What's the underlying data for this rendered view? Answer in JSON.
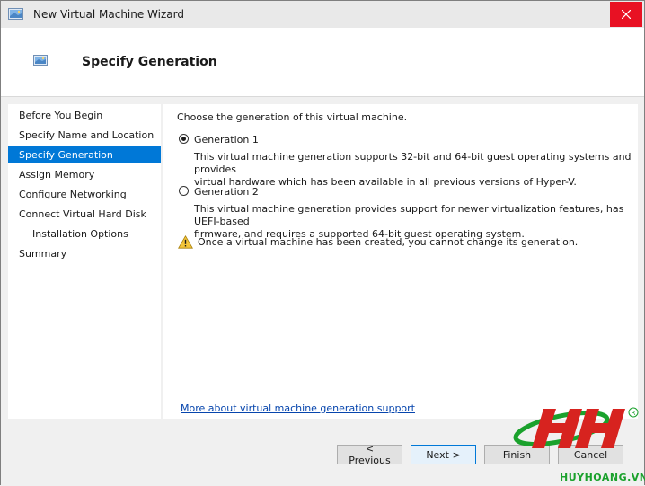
{
  "window": {
    "title": "New Virtual Machine Wizard"
  },
  "header": {
    "title": "Specify Generation"
  },
  "nav": {
    "items": [
      {
        "label": "Before You Begin"
      },
      {
        "label": "Specify Name and Location"
      },
      {
        "label": "Specify Generation"
      },
      {
        "label": "Assign Memory"
      },
      {
        "label": "Configure Networking"
      },
      {
        "label": "Connect Virtual Hard Disk"
      },
      {
        "label": "Installation Options"
      },
      {
        "label": "Summary"
      }
    ],
    "selected": "Specify Generation"
  },
  "content": {
    "prompt": "Choose the generation of this virtual machine.",
    "gen1": {
      "label": "Generation 1",
      "selected": true,
      "desc1": "This virtual machine generation supports 32-bit and 64-bit guest operating systems and provides",
      "desc2": "virtual hardware which has been available in all previous versions of Hyper-V."
    },
    "gen2": {
      "label": "Generation 2",
      "selected": false,
      "desc1": "This virtual machine generation provides support for newer virtualization features, has UEFI-based",
      "desc2": "firmware, and requires a supported 64-bit guest operating system."
    },
    "warning": "Once a virtual machine has been created, you cannot change its generation.",
    "link": "More about virtual machine generation support"
  },
  "buttons": {
    "previous": "< Previous",
    "next": "Next >",
    "finish": "Finish",
    "cancel": "Cancel"
  },
  "watermark": {
    "text": "HUYHOANG.VN",
    "brand_color": "#d7231f",
    "accent_color": "#1aa12c"
  },
  "colors": {
    "selection": "#0078d7",
    "close": "#e81123",
    "link": "#0645ad"
  }
}
